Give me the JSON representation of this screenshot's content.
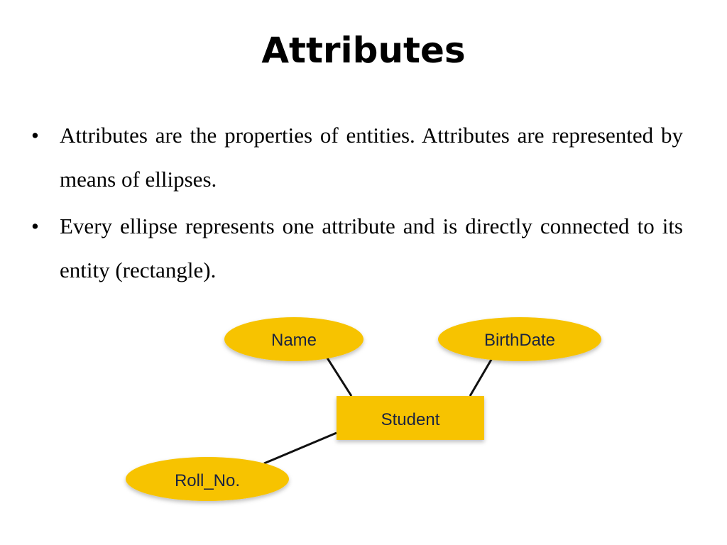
{
  "title": "Attributes",
  "bullets": [
    {
      "text": "Attributes are the properties of entities. Attributes are represented by means of ellipses."
    },
    {
      "text": "Every ellipse represents one attribute and is directly connected to its entity (rectangle)."
    }
  ],
  "diagram": {
    "colors": {
      "fill": "#f7c300",
      "edge": "#111111",
      "text": "#1a2340"
    },
    "entity": {
      "label": "Student"
    },
    "attributes": [
      {
        "label": "Name"
      },
      {
        "label": "BirthDate"
      },
      {
        "label": "Roll_No."
      }
    ]
  }
}
